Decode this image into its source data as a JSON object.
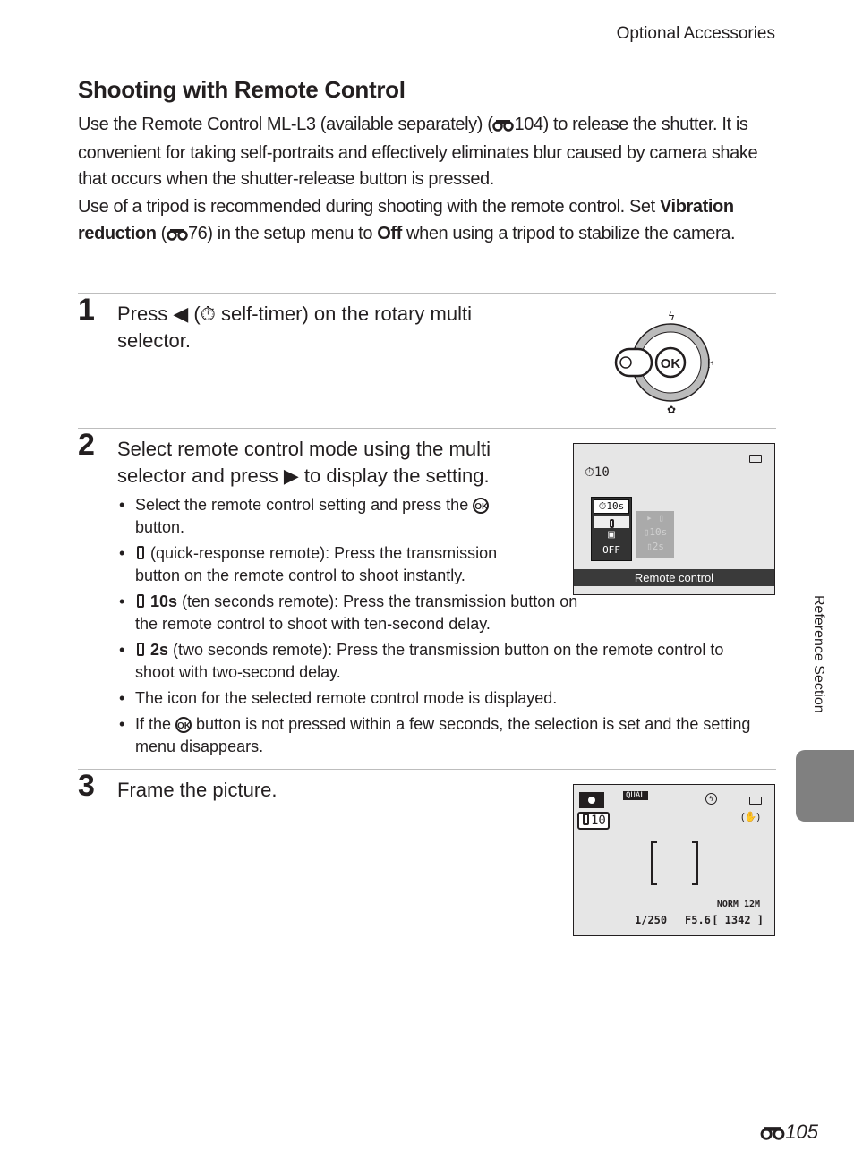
{
  "header": {
    "section": "Optional Accessories"
  },
  "title": "Shooting with Remote Control",
  "intro": {
    "p1_a": "Use the Remote Control ML-L3 (available separately) (",
    "p1_ref": "104",
    "p1_b": ") to release the shutter. It is convenient for taking self-portraits and effectively eliminates blur caused by camera shake that occurs when the shutter-release button is pressed.",
    "p2_a": "Use of a tripod is recommended during shooting with the remote control. Set ",
    "p2_bold1": "Vibration reduction",
    "p2_b": " (",
    "p2_ref": "76",
    "p2_c": ") in the setup menu to ",
    "p2_bold2": "Off",
    "p2_d": " when using a tripod to stabilize the camera."
  },
  "steps": [
    {
      "number": "1",
      "text_a": "Press ",
      "text_b": " (",
      "text_c": " self-timer) on the rotary multi selector."
    },
    {
      "number": "2",
      "text_a": "Select remote control mode using the multi selector and press ",
      "text_b": " to display the setting."
    },
    {
      "number": "3",
      "text": "Frame the picture."
    }
  ],
  "step2_bullets": [
    {
      "a": "Select the remote control setting and press the ",
      "ok": "OK",
      "b": " button."
    },
    {
      "bold": "",
      "b": " (quick-response remote): Press the transmission button on the remote control to shoot instantly."
    },
    {
      "bold": "10s",
      "b": " (ten seconds remote): Press the transmission button on the remote control to shoot with ten-second delay."
    },
    {
      "bold": "2s",
      "b": " (two seconds remote): Press the transmission button on the remote control to shoot with two-second delay."
    },
    {
      "a": "The icon for the selected remote control mode is displayed."
    },
    {
      "a": "If the ",
      "ok": "OK",
      "b": " button is not pressed within a few seconds, the selection is set and the setting menu disappears."
    }
  ],
  "dial": {
    "center_label": "OK",
    "top_icon": "flash-icon",
    "right_icon": "exposure-comp-icon",
    "bottom_icon": "macro-icon",
    "left_icon": "self-timer-icon"
  },
  "screen1": {
    "timer_indicator": "10",
    "menu_items": [
      "10s",
      "",
      "",
      "OFF"
    ],
    "submenu_items": [
      "",
      "10s",
      "2s"
    ],
    "caption": "Remote control"
  },
  "screen2": {
    "quality_badge": "QUAL",
    "remote_indicator": "10",
    "shutter": "1/250",
    "aperture": "F5.6",
    "image_mode": "NORM",
    "image_size": "12M",
    "frames_remaining": "[ 1342 ]"
  },
  "side_label": "Reference Section",
  "page_number": "105"
}
